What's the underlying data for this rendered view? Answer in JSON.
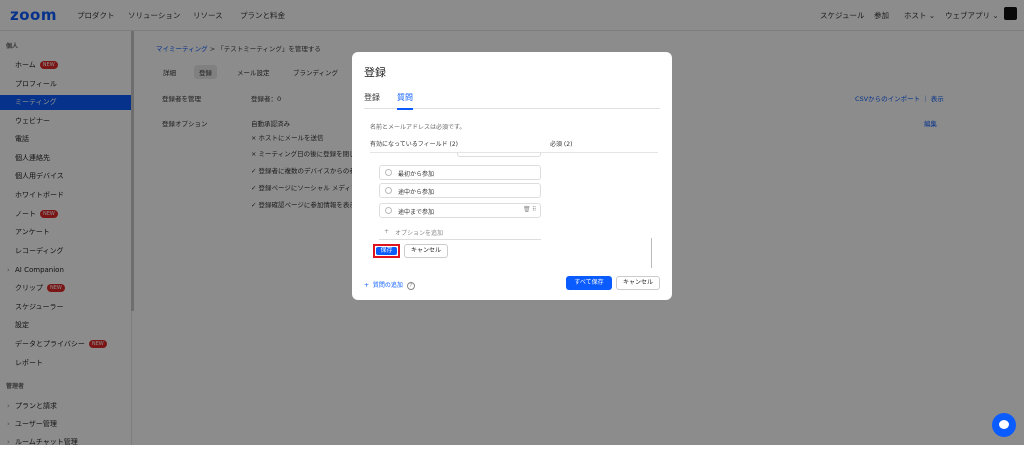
{
  "logo": "zoom",
  "topnav": {
    "left": [
      "プロダクト",
      "ソリューション",
      "リソース",
      "プランと料金"
    ],
    "right": [
      "スケジュール",
      "参加",
      "ホスト",
      "ウェブアプリ"
    ]
  },
  "sidebar": {
    "section_personal": "個人",
    "section_admin": "管理者",
    "badge_new": "NEW",
    "items": [
      {
        "label": "ホーム"
      },
      {
        "label": "プロフィール"
      },
      {
        "label": "ミーティング"
      },
      {
        "label": "ウェビナー"
      },
      {
        "label": "電話"
      },
      {
        "label": "個人連絡先"
      },
      {
        "label": "個人用デバイス"
      },
      {
        "label": "ホワイトボード"
      },
      {
        "label": "ノート"
      },
      {
        "label": "アンケート"
      },
      {
        "label": "レコーディング"
      },
      {
        "label": "AI Companion"
      },
      {
        "label": "クリップ"
      },
      {
        "label": "スケジューラー"
      },
      {
        "label": "設定"
      },
      {
        "label": "データとプライバシー"
      },
      {
        "label": "レポート"
      }
    ],
    "admin_items": [
      {
        "label": "プランと請求"
      },
      {
        "label": "ユーザー管理"
      },
      {
        "label": "ルームチャット管理"
      }
    ]
  },
  "main": {
    "breadcrumb_link": "マイミーティング",
    "breadcrumb_sep": ">",
    "breadcrumb_current": "「テストミーティング」を管理する",
    "tabs": [
      "詳細",
      "登録",
      "メール設定",
      "ブランディング"
    ],
    "manage_registrants_label": "登録者を管理",
    "registrants_count": "登録者：0",
    "csv_import": "CSVからのインポート",
    "view": "表示",
    "reg_options_label": "登録オプション",
    "auto_approve": "自動承認済み",
    "edit": "編集",
    "options": [
      "× ホストにメールを送信",
      "× ミーティング日の後に登録を閉じ",
      "✓ 登録者に複数のデバイスからの参",
      "✓ 登録ページにソーシャル メディア",
      "✓ 登録確認ページに参加情報を表示"
    ]
  },
  "modal": {
    "title": "登録",
    "tabs": [
      "登録",
      "質問"
    ],
    "note": "名前とメールアドレスは必須です。",
    "col_enabled": "有効になっているフィールド (2)",
    "col_required": "必須 (2)",
    "options": [
      "最初から参加",
      "途中から参加",
      "途中まで参加"
    ],
    "add_option": "オプションを追加",
    "save": "保存",
    "cancel": "キャンセル",
    "add_question": "質問の追加",
    "save_all": "すべて保存",
    "cancel2": "キャンセル"
  },
  "colors": {
    "accent": "#0b5cff",
    "highlight": "#e0141e"
  }
}
